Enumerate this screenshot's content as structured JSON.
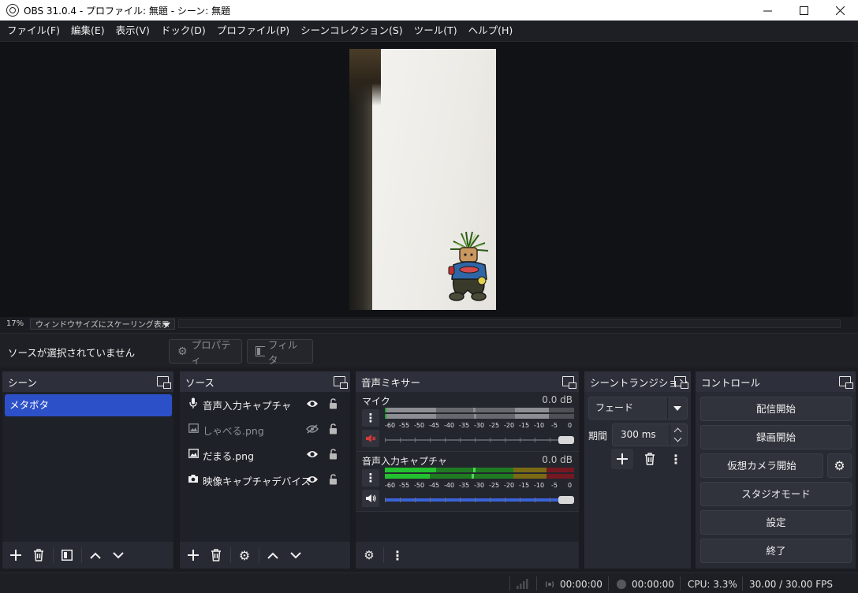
{
  "window": {
    "title": "OBS 31.0.4 - プロファイル: 無題 - シーン: 無題",
    "minimize": "—",
    "maximize": "☐",
    "close": "✕"
  },
  "menu": [
    "ファイル(F)",
    "編集(E)",
    "表示(V)",
    "ドック(D)",
    "プロファイル(P)",
    "シーンコレクション(S)",
    "ツール(T)",
    "ヘルプ(H)"
  ],
  "preview": {
    "zoom": "17%",
    "scale_mode": "ウィンドウサイズにスケーリング表示"
  },
  "source_toolbar": {
    "no_selection": "ソースが選択されていません",
    "properties": "プロパティ",
    "filters": "フィルタ"
  },
  "scenes": {
    "title": "シーン",
    "items": [
      {
        "label": "メタボタ",
        "selected": true
      }
    ]
  },
  "sources": {
    "title": "ソース",
    "items": [
      {
        "label": "音声入力キャプチャ",
        "icon": "mic-icon",
        "visible": true,
        "locked": false
      },
      {
        "label": "しゃべる.png",
        "icon": "image-icon",
        "visible": false,
        "locked": false
      },
      {
        "label": "だまる.png",
        "icon": "image-icon",
        "visible": true,
        "locked": false
      },
      {
        "label": "映像キャプチャデバイス",
        "icon": "camera-icon",
        "visible": true,
        "locked": false
      }
    ]
  },
  "mixer": {
    "title": "音声ミキサー",
    "ticks": [
      "-60",
      "-55",
      "-50",
      "-45",
      "-40",
      "-35",
      "-30",
      "-25",
      "-20",
      "-15",
      "-10",
      "-5",
      "0"
    ],
    "channels": [
      {
        "name": "マイク",
        "db": "0.0 dB",
        "muted": true,
        "volume": 1.0
      },
      {
        "name": "音声入力キャプチャ",
        "db": "0.0 dB",
        "muted": false,
        "volume": 1.0
      }
    ]
  },
  "transitions": {
    "title": "シーントランジション",
    "selected": "フェード",
    "duration_label": "期間",
    "duration": "300 ms"
  },
  "controls": {
    "title": "コントロール",
    "start_streaming": "配信開始",
    "start_recording": "録画開始",
    "start_virtual_cam": "仮想カメラ開始",
    "studio_mode": "スタジオモード",
    "settings": "設定",
    "exit": "終了"
  },
  "status": {
    "stream_time": "00:00:00",
    "record_time": "00:00:00",
    "cpu": "CPU: 3.3%",
    "fps": "30.00 / 30.00 FPS"
  },
  "colors": {
    "accent": "#2c50c8",
    "muted": "#d23b3b",
    "meter_green": "#2fbf3b",
    "meter_yellow": "#b0a02a",
    "meter_red": "#b2232e"
  }
}
